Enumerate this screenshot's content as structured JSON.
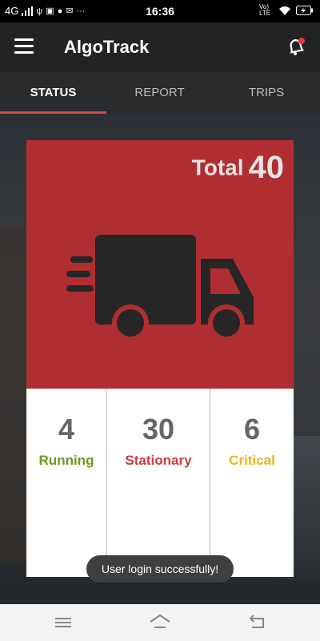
{
  "status_bar": {
    "network": "4G",
    "time": "16:36",
    "lte_label": "Vo) LTE",
    "icons": [
      "signal-icon",
      "usb-icon",
      "notification-icon",
      "alert-icon",
      "mail-icon",
      "more-icon",
      "wifi-icon",
      "battery-icon"
    ]
  },
  "app": {
    "title": "AlgoTrack",
    "menu_icon": "hamburger-icon",
    "bell_icon": "bell-icon",
    "accent": "#b02e31"
  },
  "tabs": [
    {
      "label": "STATUS",
      "active": true
    },
    {
      "label": "REPORT",
      "active": false
    },
    {
      "label": "TRIPS",
      "active": false
    }
  ],
  "summary": {
    "total_label": "Total",
    "total_value": "40",
    "stats": [
      {
        "value": "4",
        "label": "Running",
        "color": "#6b9a1a"
      },
      {
        "value": "30",
        "label": "Stationary",
        "color": "#c93a3e"
      },
      {
        "value": "6",
        "label": "Critical",
        "color": "#e6b622"
      }
    ]
  },
  "toast": "User login successfully!",
  "nav": [
    "menu-icon",
    "home-icon",
    "back-icon"
  ]
}
